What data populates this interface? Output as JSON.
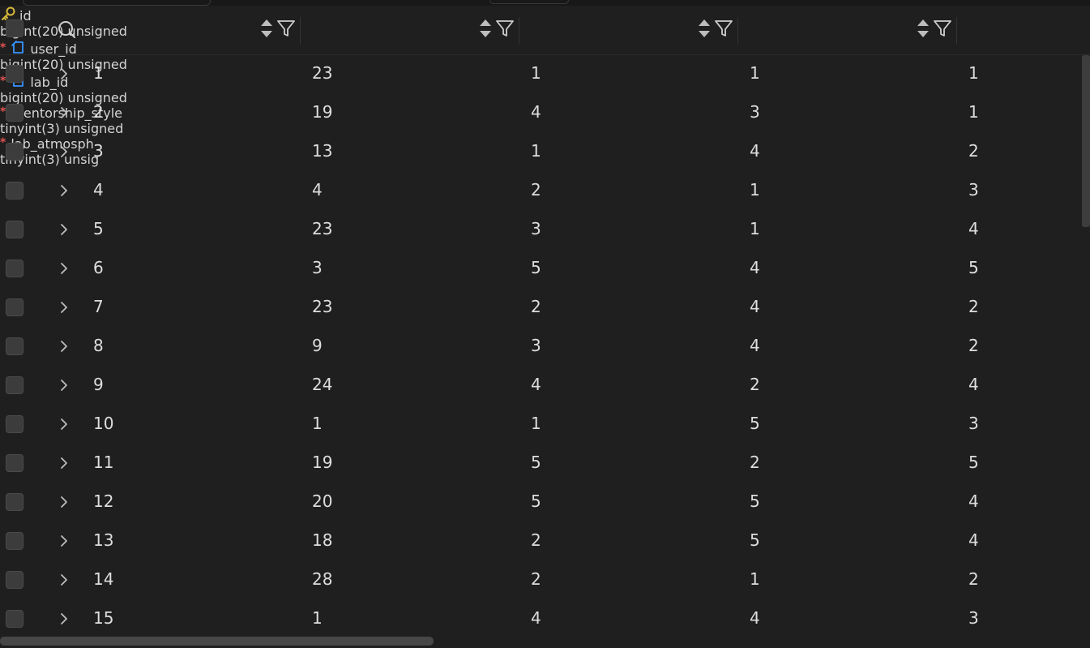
{
  "columns": [
    {
      "key": "id",
      "name": "id",
      "type": "bigint(20) unsigned",
      "required": "",
      "icon": "key-icon",
      "key_color": "#d7ba3a"
    },
    {
      "key": "user_id",
      "name": "user_id",
      "type": "bigint(20) unsigned",
      "required": "*",
      "icon": "foreign-key-icon",
      "key_color": "#3794ff"
    },
    {
      "key": "lab_id",
      "name": "lab_id",
      "type": "bigint(20) unsigned",
      "required": "*",
      "icon": "foreign-key-icon",
      "key_color": "#3794ff"
    },
    {
      "key": "mentorship_style",
      "name": "mentorship_style",
      "type": "tinyint(3) unsigned",
      "required": "*",
      "icon": "",
      "key_color": ""
    },
    {
      "key": "lab_atmosphere",
      "name": "lab_atmosph",
      "type": "tinyint(3) unsig",
      "required": "*",
      "icon": "",
      "key_color": ""
    }
  ],
  "rows": [
    [
      "1",
      "23",
      "1",
      "1",
      "1"
    ],
    [
      "2",
      "19",
      "4",
      "3",
      "1"
    ],
    [
      "3",
      "13",
      "1",
      "4",
      "2"
    ],
    [
      "4",
      "4",
      "2",
      "1",
      "3"
    ],
    [
      "5",
      "23",
      "3",
      "1",
      "4"
    ],
    [
      "6",
      "3",
      "5",
      "4",
      "5"
    ],
    [
      "7",
      "23",
      "2",
      "4",
      "2"
    ],
    [
      "8",
      "9",
      "3",
      "4",
      "2"
    ],
    [
      "9",
      "24",
      "4",
      "2",
      "4"
    ],
    [
      "10",
      "1",
      "1",
      "5",
      "3"
    ],
    [
      "11",
      "19",
      "5",
      "2",
      "5"
    ],
    [
      "12",
      "20",
      "5",
      "5",
      "4"
    ],
    [
      "13",
      "18",
      "2",
      "5",
      "4"
    ],
    [
      "14",
      "28",
      "2",
      "1",
      "2"
    ],
    [
      "15",
      "1",
      "4",
      "4",
      "3"
    ]
  ],
  "colors": {
    "background": "#1f1f1f",
    "text": "#dedede",
    "type_text": "#a9a9a9",
    "required": "#e05252",
    "checkbox": "#3c3c3c"
  }
}
